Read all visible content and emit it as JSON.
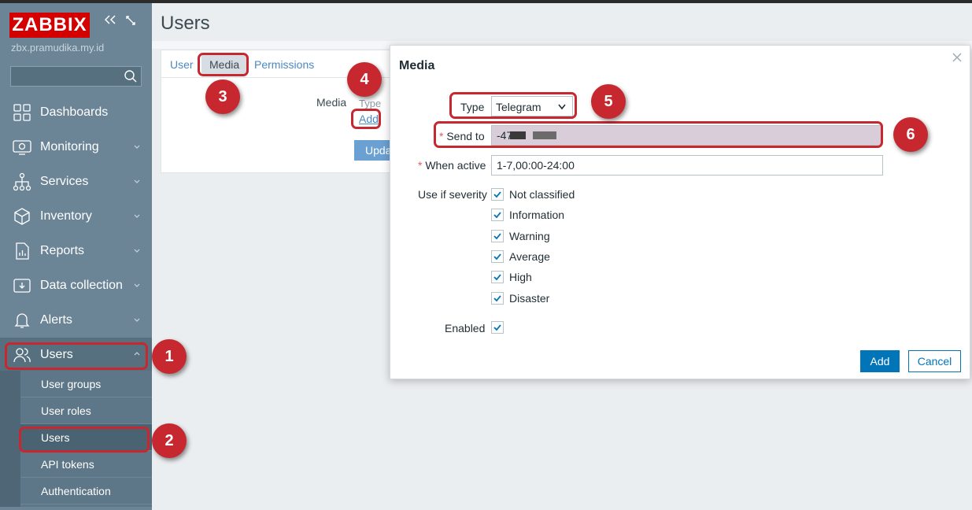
{
  "app": {
    "logo": "ZABBIX",
    "hostname": "zbx.pramudika.my.id",
    "collapse_icon": "double-chevron-left-icon",
    "kiosk_icon": "expand-icon"
  },
  "sidebar": {
    "search_placeholder": "",
    "items": [
      {
        "label": "Dashboards",
        "icon": "dashboard-icon"
      },
      {
        "label": "Monitoring",
        "icon": "monitor-icon"
      },
      {
        "label": "Services",
        "icon": "hierarchy-icon"
      },
      {
        "label": "Inventory",
        "icon": "cube-icon"
      },
      {
        "label": "Reports",
        "icon": "report-icon"
      },
      {
        "label": "Data collection",
        "icon": "download-icon"
      },
      {
        "label": "Alerts",
        "icon": "bell-icon"
      },
      {
        "label": "Users",
        "icon": "users-icon"
      }
    ],
    "submenu": [
      {
        "label": "User groups"
      },
      {
        "label": "User roles"
      },
      {
        "label": "Users"
      },
      {
        "label": "API tokens"
      },
      {
        "label": "Authentication"
      }
    ]
  },
  "main": {
    "title": "Users",
    "tabs": [
      {
        "label": "User"
      },
      {
        "label": "Media"
      },
      {
        "label": "Permissions"
      }
    ],
    "media_label": "Media",
    "type_column": "Type",
    "add_link": "Add",
    "update_button": "Update"
  },
  "dialog": {
    "title": "Media",
    "type_label": "Type",
    "type_value": "Telegram",
    "send_to_label": "Send to",
    "send_to_value": "-47",
    "when_active_label": "When active",
    "when_active_value": "1-7,00:00-24:00",
    "severity_label": "Use if severity",
    "severities": [
      {
        "label": "Not classified",
        "checked": true
      },
      {
        "label": "Information",
        "checked": true
      },
      {
        "label": "Warning",
        "checked": true
      },
      {
        "label": "Average",
        "checked": true
      },
      {
        "label": "High",
        "checked": true
      },
      {
        "label": "Disaster",
        "checked": true
      }
    ],
    "enabled_label": "Enabled",
    "enabled": true,
    "required_mark": "*",
    "add_button": "Add",
    "cancel_button": "Cancel"
  },
  "annotations": [
    "1",
    "2",
    "3",
    "4",
    "5",
    "6"
  ],
  "colors": {
    "sidebar": "#6b8597",
    "logo": "#d40000",
    "accent": "#0275b8",
    "annotation": "#c7282f",
    "link": "#4b89c0"
  }
}
